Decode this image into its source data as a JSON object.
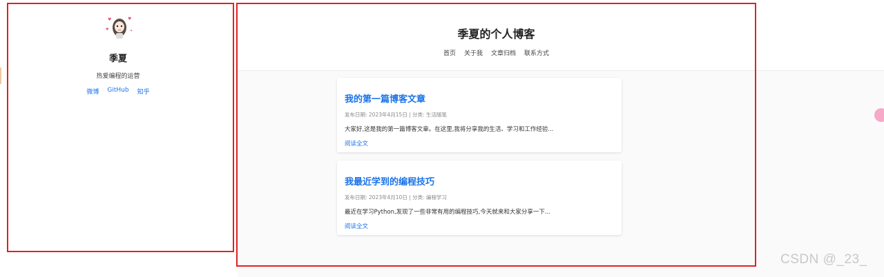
{
  "profile": {
    "name": "季夏",
    "bio": "热爱编程的运营",
    "links": [
      "微博",
      "GitHub",
      "知乎"
    ]
  },
  "site": {
    "title": "季夏的个人博客",
    "nav": [
      "首页",
      "关于我",
      "文章归档",
      "联系方式"
    ]
  },
  "posts": [
    {
      "title": "我的第一篇博客文章",
      "meta": "发布日期: 2023年4月15日 | 分类: 生活随笔",
      "excerpt": "大家好,这是我的第一篇博客文章。在这里,我将分享我的生活、学习和工作经验...",
      "read_more": "阅读全文"
    },
    {
      "title": "我最近学到的编程技巧",
      "meta": "发布日期: 2023年4月10日 | 分类: 编程学习",
      "excerpt": "最近在学习Python,发现了一些非常有用的编程技巧,今天就来和大家分享一下...",
      "read_more": "阅读全文"
    }
  ],
  "watermark": "CSDN @_23_",
  "colors": {
    "link": "#1a73e8",
    "annotation_border": "#e02020"
  },
  "icons": {
    "avatar": "girl-avatar-icon",
    "floating_widget": "pink-float-icon"
  }
}
